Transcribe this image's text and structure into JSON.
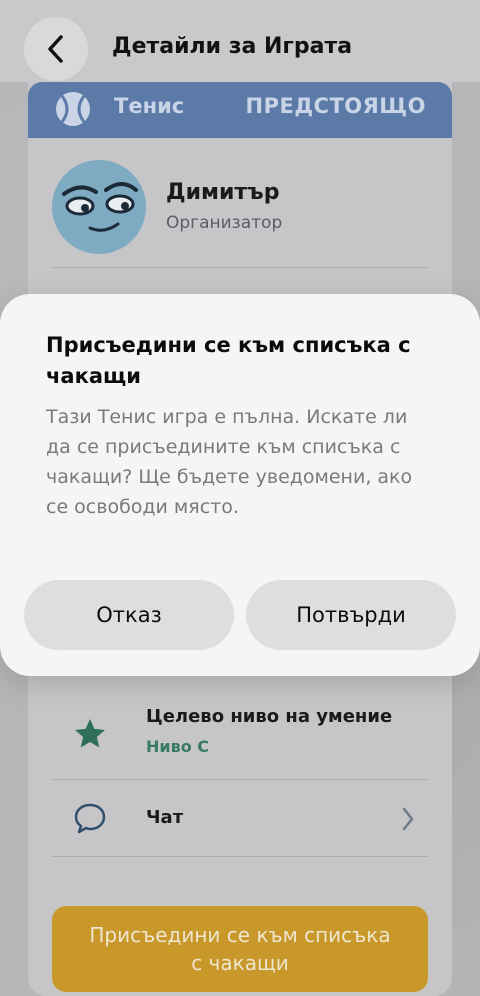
{
  "nav": {
    "title": "Детайли за Играта",
    "back_icon": "chevron-left-icon"
  },
  "banner": {
    "sport": "Тенис",
    "status": "ПРЕДСТОЯЩО",
    "icon": "tennis-ball-icon"
  },
  "organizer": {
    "name": "Димитър",
    "role": "Организатор",
    "avatar": "cartoon-face-avatar"
  },
  "details": [
    {
      "icon": "star-icon",
      "title": "Целево ниво на умение",
      "value": "Ниво C"
    },
    {
      "icon": "chat-bubble-icon",
      "title": "Чат",
      "trailing_icon": "chevron-right-icon"
    }
  ],
  "join_button": {
    "label_line1": "Присъедини се към списъка",
    "label_line2": "с чакащи"
  },
  "modal": {
    "title": "Присъедини се към списъка с чакащи",
    "body": "Тази Тенис игра е пълна. Искате ли да се присъедините към списъка с чакащи? Ще бъдете уведомени, ако се освободи място.",
    "cancel_label": "Отказ",
    "confirm_label": "Потвърди"
  },
  "colors": {
    "banner": "#5b7aa8",
    "accent_green": "#3a7a62",
    "join_button": "#c8982a",
    "modal_bg": "#f5f5f6"
  }
}
